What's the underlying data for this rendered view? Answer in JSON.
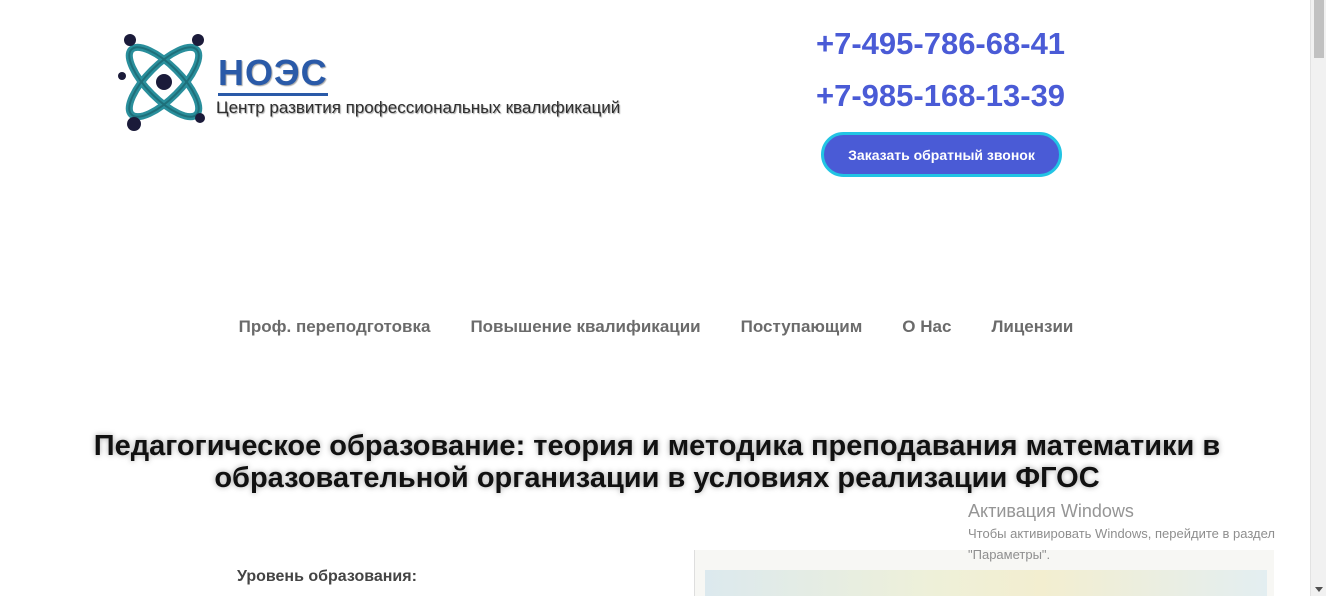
{
  "header": {
    "logo": {
      "brand": "НОЭС",
      "tagline": "Центр развития профессиональных квалификаций",
      "icon": "atom-icon",
      "colors": {
        "orbit": "#2a8f9c",
        "dot": "#1b1b3a",
        "brand": "#2a5aa8"
      }
    },
    "phones": [
      "+7-495-786-68-41",
      "+7-985-168-13-39"
    ],
    "callback_label": "Заказать обратный звонок",
    "accent_color": "#4a5bd6",
    "button_border_color": "#22c4e4"
  },
  "nav": {
    "items": [
      {
        "label": "Проф. переподготовка"
      },
      {
        "label": "Повышение квалификации"
      },
      {
        "label": "Поступающим"
      },
      {
        "label": "О Нас"
      },
      {
        "label": "Лицензии"
      }
    ]
  },
  "main": {
    "title": "Педагогическое образование: теория и методика преподавания математики в образовательной организации в условиях реализации ФГОС",
    "edu_level_label": "Уровень образования:"
  },
  "watermark": {
    "title": "Активация Windows",
    "text": "Чтобы активировать Windows, перейдите в раздел \"Параметры\"."
  }
}
